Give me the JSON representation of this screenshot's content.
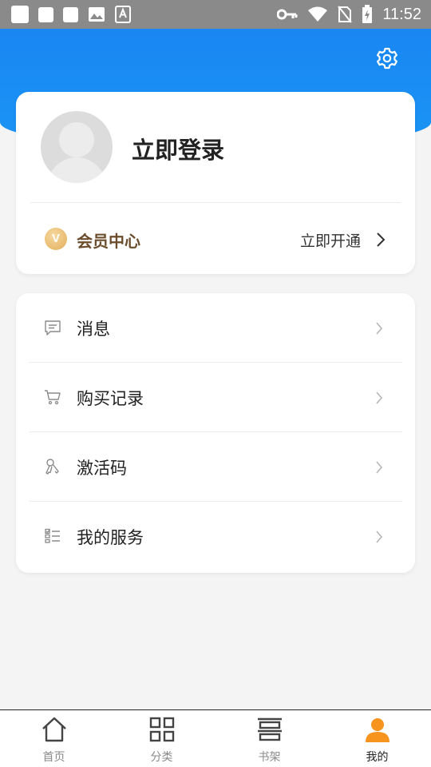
{
  "status_bar": {
    "time": "11:52"
  },
  "profile": {
    "login_label": "立即登录"
  },
  "vip": {
    "badge": "V",
    "label": "会员中心",
    "action": "立即开通"
  },
  "menu": [
    {
      "label": "消息",
      "icon": "message-icon"
    },
    {
      "label": "购买记录",
      "icon": "cart-icon"
    },
    {
      "label": "激活码",
      "icon": "key-icon"
    },
    {
      "label": "我的服务",
      "icon": "service-list-icon"
    }
  ],
  "bottom_nav": [
    {
      "label": "首页",
      "icon": "home-icon",
      "active": false
    },
    {
      "label": "分类",
      "icon": "grid-icon",
      "active": false
    },
    {
      "label": "书架",
      "icon": "bookshelf-icon",
      "active": false
    },
    {
      "label": "我的",
      "icon": "person-icon",
      "active": true
    }
  ],
  "colors": {
    "header_blue": "#1a86f2",
    "active_orange": "#f7941d",
    "vip_gold": "#e2ad5a"
  }
}
